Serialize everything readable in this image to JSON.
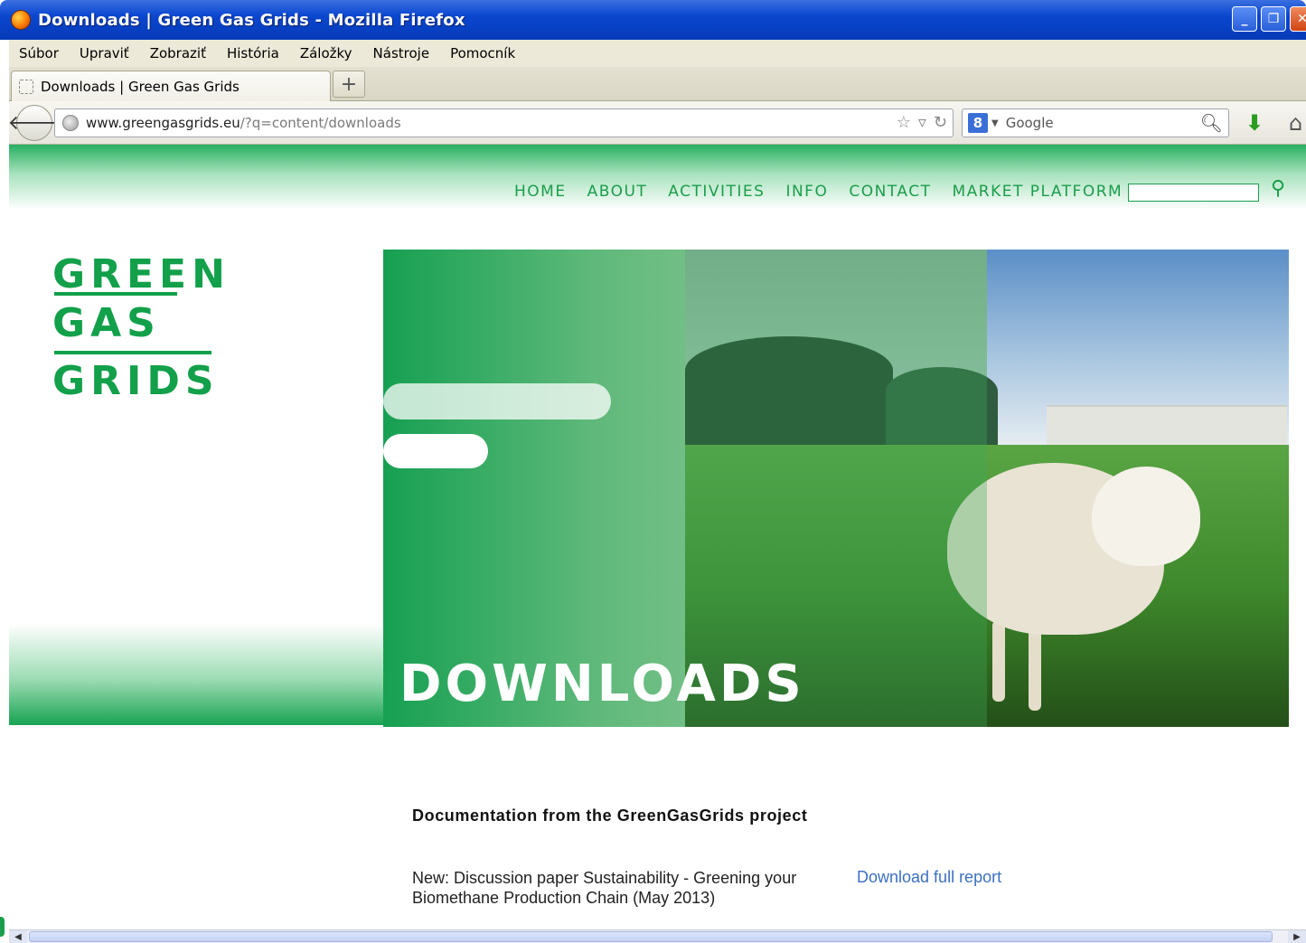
{
  "window": {
    "title": "Downloads | Green Gas Grids - Mozilla Firefox"
  },
  "menubar": {
    "items": [
      "Súbor",
      "Upraviť",
      "Zobraziť",
      "História",
      "Záložky",
      "Nástroje",
      "Pomocník"
    ]
  },
  "tabs": {
    "active_tab": "Downloads | Green Gas Grids",
    "new_tab_label": "+"
  },
  "navbar": {
    "url_host": "www.greengasgrids.eu",
    "url_path": "/?q=content/downloads",
    "search_engine_glyph": "8",
    "search_placeholder": "Google"
  },
  "site": {
    "nav": [
      "HOME",
      "ABOUT",
      "ACTIVITIES",
      "INFO",
      "CONTACT",
      "MARKET PLATFORM"
    ],
    "logo_lines": [
      "GREEN",
      "GAS",
      "GRIDS"
    ],
    "hero_title": "DOWNLOADS",
    "section_heading": "Documentation from the GreenGasGrids project",
    "doc_description": "New: Discussion paper Sustainability - Greening your Biomethane Production Chain (May 2013)",
    "doc_link": "Download full report",
    "brand_color": "#12a04a"
  },
  "icons": {
    "back": "back-arrow-icon",
    "star": "bookmark-star-icon",
    "reload": "reload-icon",
    "search": "magnifier-icon",
    "download": "download-arrow-icon",
    "home": "home-icon"
  }
}
